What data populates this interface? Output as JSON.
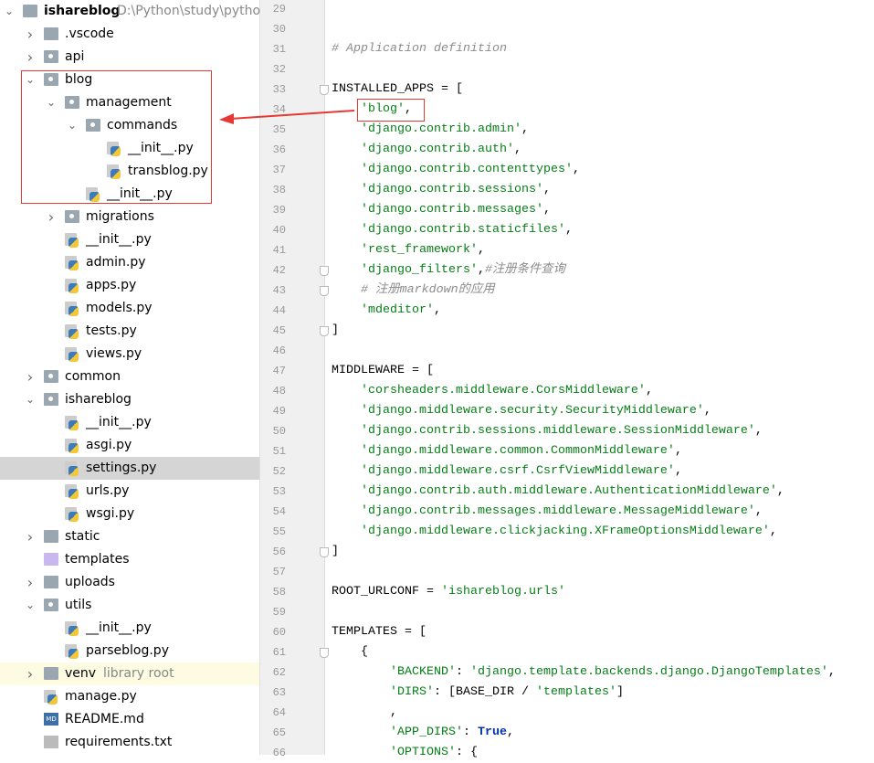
{
  "project_tree": {
    "root": {
      "label": "ishareblog",
      "path": "D:\\Python\\study\\pytho"
    },
    "items": [
      {
        "label": ".vscode",
        "type": "folder",
        "level": 1,
        "state": "collapsed"
      },
      {
        "label": "api",
        "type": "package",
        "level": 1,
        "state": "collapsed"
      },
      {
        "label": "blog",
        "type": "package",
        "level": 1,
        "state": "expanded"
      },
      {
        "label": "management",
        "type": "package",
        "level": 2,
        "state": "expanded"
      },
      {
        "label": "commands",
        "type": "package",
        "level": 3,
        "state": "expanded"
      },
      {
        "label": "__init__.py",
        "type": "py",
        "level": 4
      },
      {
        "label": "transblog.py",
        "type": "py",
        "level": 4
      },
      {
        "label": "__init__.py",
        "type": "py",
        "level": 3
      },
      {
        "label": "migrations",
        "type": "package",
        "level": 2,
        "state": "collapsed"
      },
      {
        "label": "__init__.py",
        "type": "py",
        "level": 2
      },
      {
        "label": "admin.py",
        "type": "py",
        "level": 2
      },
      {
        "label": "apps.py",
        "type": "py",
        "level": 2
      },
      {
        "label": "models.py",
        "type": "py",
        "level": 2
      },
      {
        "label": "tests.py",
        "type": "py",
        "level": 2
      },
      {
        "label": "views.py",
        "type": "py",
        "level": 2
      },
      {
        "label": "common",
        "type": "package",
        "level": 1,
        "state": "collapsed"
      },
      {
        "label": "ishareblog",
        "type": "package",
        "level": 1,
        "state": "expanded"
      },
      {
        "label": "__init__.py",
        "type": "py",
        "level": 2
      },
      {
        "label": "asgi.py",
        "type": "py",
        "level": 2
      },
      {
        "label": "settings.py",
        "type": "py",
        "level": 2,
        "selected": true
      },
      {
        "label": "urls.py",
        "type": "py",
        "level": 2
      },
      {
        "label": "wsgi.py",
        "type": "py",
        "level": 2
      },
      {
        "label": "static",
        "type": "folder",
        "level": 1,
        "state": "collapsed"
      },
      {
        "label": "templates",
        "type": "templates",
        "level": 1
      },
      {
        "label": "uploads",
        "type": "folder",
        "level": 1,
        "state": "collapsed"
      },
      {
        "label": "utils",
        "type": "package",
        "level": 1,
        "state": "expanded"
      },
      {
        "label": "__init__.py",
        "type": "py",
        "level": 2
      },
      {
        "label": "parseblog.py",
        "type": "py",
        "level": 2
      },
      {
        "label": "venv",
        "type": "folder",
        "level": 1,
        "state": "collapsed",
        "hint": "library root"
      },
      {
        "label": "manage.py",
        "type": "py",
        "level": 1
      },
      {
        "label": "README.md",
        "type": "md",
        "level": 1
      },
      {
        "label": "requirements.txt",
        "type": "txt",
        "level": 1
      }
    ]
  },
  "editor": {
    "first_line": 29,
    "lines": [
      [],
      [],
      [
        [
          "c",
          "# Application definition"
        ]
      ],
      [],
      [
        [
          "t",
          "INSTALLED_APPS = ["
        ]
      ],
      [
        [
          "t",
          "    "
        ],
        [
          "s",
          "'blog'"
        ],
        [
          "t",
          ","
        ]
      ],
      [
        [
          "t",
          "    "
        ],
        [
          "s",
          "'django.contrib.admin'"
        ],
        [
          "t",
          ","
        ]
      ],
      [
        [
          "t",
          "    "
        ],
        [
          "s",
          "'django.contrib.auth'"
        ],
        [
          "t",
          ","
        ]
      ],
      [
        [
          "t",
          "    "
        ],
        [
          "s",
          "'django.contrib.contenttypes'"
        ],
        [
          "t",
          ","
        ]
      ],
      [
        [
          "t",
          "    "
        ],
        [
          "s",
          "'django.contrib.sessions'"
        ],
        [
          "t",
          ","
        ]
      ],
      [
        [
          "t",
          "    "
        ],
        [
          "s",
          "'django.contrib.messages'"
        ],
        [
          "t",
          ","
        ]
      ],
      [
        [
          "t",
          "    "
        ],
        [
          "s",
          "'django.contrib.staticfiles'"
        ],
        [
          "t",
          ","
        ]
      ],
      [
        [
          "t",
          "    "
        ],
        [
          "s",
          "'rest_framework'"
        ],
        [
          "t",
          ","
        ]
      ],
      [
        [
          "t",
          "    "
        ],
        [
          "s",
          "'django_filters'"
        ],
        [
          "t",
          ","
        ],
        [
          "c",
          "#注册条件查询"
        ]
      ],
      [
        [
          "t",
          "    "
        ],
        [
          "c",
          "# 注册markdown的应用"
        ]
      ],
      [
        [
          "t",
          "    "
        ],
        [
          "s",
          "'mdeditor'"
        ],
        [
          "t",
          ","
        ]
      ],
      [
        [
          "t",
          "]"
        ]
      ],
      [],
      [
        [
          "t",
          "MIDDLEWARE = ["
        ]
      ],
      [
        [
          "t",
          "    "
        ],
        [
          "s",
          "'corsheaders.middleware.CorsMiddleware'"
        ],
        [
          "t",
          ","
        ]
      ],
      [
        [
          "t",
          "    "
        ],
        [
          "s",
          "'django.middleware.security.SecurityMiddleware'"
        ],
        [
          "t",
          ","
        ]
      ],
      [
        [
          "t",
          "    "
        ],
        [
          "s",
          "'django.contrib.sessions.middleware.SessionMiddleware'"
        ],
        [
          "t",
          ","
        ]
      ],
      [
        [
          "t",
          "    "
        ],
        [
          "s",
          "'django.middleware.common.CommonMiddleware'"
        ],
        [
          "t",
          ","
        ]
      ],
      [
        [
          "t",
          "    "
        ],
        [
          "s",
          "'django.middleware.csrf.CsrfViewMiddleware'"
        ],
        [
          "t",
          ","
        ]
      ],
      [
        [
          "t",
          "    "
        ],
        [
          "s",
          "'django.contrib.auth.middleware.AuthenticationMiddleware'"
        ],
        [
          "t",
          ","
        ]
      ],
      [
        [
          "t",
          "    "
        ],
        [
          "s",
          "'django.contrib.messages.middleware.MessageMiddleware'"
        ],
        [
          "t",
          ","
        ]
      ],
      [
        [
          "t",
          "    "
        ],
        [
          "s",
          "'django.middleware.clickjacking.XFrameOptionsMiddleware'"
        ],
        [
          "t",
          ","
        ]
      ],
      [
        [
          "t",
          "]"
        ]
      ],
      [],
      [
        [
          "t",
          "ROOT_URLCONF = "
        ],
        [
          "s",
          "'ishareblog.urls'"
        ]
      ],
      [],
      [
        [
          "t",
          "TEMPLATES = ["
        ]
      ],
      [
        [
          "t",
          "    {"
        ]
      ],
      [
        [
          "t",
          "        "
        ],
        [
          "s",
          "'BACKEND'"
        ],
        [
          "t",
          ": "
        ],
        [
          "s",
          "'django.template.backends.django.DjangoTemplates'"
        ],
        [
          "t",
          ","
        ]
      ],
      [
        [
          "t",
          "        "
        ],
        [
          "s",
          "'DIRS'"
        ],
        [
          "t",
          ": [BASE_DIR / "
        ],
        [
          "s",
          "'templates'"
        ],
        [
          "t",
          "]"
        ]
      ],
      [
        [
          "t",
          "        ,"
        ]
      ],
      [
        [
          "t",
          "        "
        ],
        [
          "s",
          "'APP_DIRS'"
        ],
        [
          "t",
          ": "
        ],
        [
          "k",
          "True"
        ],
        [
          "t",
          ","
        ]
      ],
      [
        [
          "t",
          "        "
        ],
        [
          "s",
          "'OPTIONS'"
        ],
        [
          "t",
          ": {"
        ]
      ]
    ],
    "fold_lines": [
      33,
      42,
      43,
      45,
      56,
      61
    ]
  }
}
